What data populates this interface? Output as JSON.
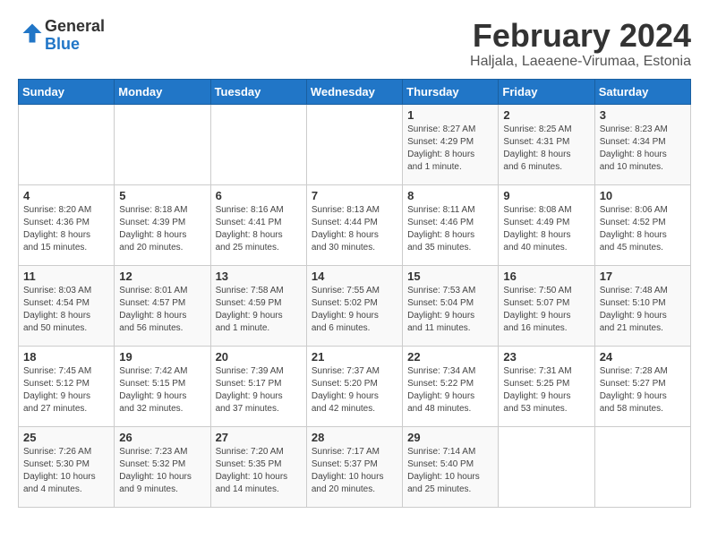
{
  "header": {
    "logo_general": "General",
    "logo_blue": "Blue",
    "title": "February 2024",
    "subtitle": "Haljala, Laeaene-Virumaa, Estonia"
  },
  "weekdays": [
    "Sunday",
    "Monday",
    "Tuesday",
    "Wednesday",
    "Thursday",
    "Friday",
    "Saturday"
  ],
  "weeks": [
    [
      {
        "day": "",
        "info": ""
      },
      {
        "day": "",
        "info": ""
      },
      {
        "day": "",
        "info": ""
      },
      {
        "day": "",
        "info": ""
      },
      {
        "day": "1",
        "info": "Sunrise: 8:27 AM\nSunset: 4:29 PM\nDaylight: 8 hours\nand 1 minute."
      },
      {
        "day": "2",
        "info": "Sunrise: 8:25 AM\nSunset: 4:31 PM\nDaylight: 8 hours\nand 6 minutes."
      },
      {
        "day": "3",
        "info": "Sunrise: 8:23 AM\nSunset: 4:34 PM\nDaylight: 8 hours\nand 10 minutes."
      }
    ],
    [
      {
        "day": "4",
        "info": "Sunrise: 8:20 AM\nSunset: 4:36 PM\nDaylight: 8 hours\nand 15 minutes."
      },
      {
        "day": "5",
        "info": "Sunrise: 8:18 AM\nSunset: 4:39 PM\nDaylight: 8 hours\nand 20 minutes."
      },
      {
        "day": "6",
        "info": "Sunrise: 8:16 AM\nSunset: 4:41 PM\nDaylight: 8 hours\nand 25 minutes."
      },
      {
        "day": "7",
        "info": "Sunrise: 8:13 AM\nSunset: 4:44 PM\nDaylight: 8 hours\nand 30 minutes."
      },
      {
        "day": "8",
        "info": "Sunrise: 8:11 AM\nSunset: 4:46 PM\nDaylight: 8 hours\nand 35 minutes."
      },
      {
        "day": "9",
        "info": "Sunrise: 8:08 AM\nSunset: 4:49 PM\nDaylight: 8 hours\nand 40 minutes."
      },
      {
        "day": "10",
        "info": "Sunrise: 8:06 AM\nSunset: 4:52 PM\nDaylight: 8 hours\nand 45 minutes."
      }
    ],
    [
      {
        "day": "11",
        "info": "Sunrise: 8:03 AM\nSunset: 4:54 PM\nDaylight: 8 hours\nand 50 minutes."
      },
      {
        "day": "12",
        "info": "Sunrise: 8:01 AM\nSunset: 4:57 PM\nDaylight: 8 hours\nand 56 minutes."
      },
      {
        "day": "13",
        "info": "Sunrise: 7:58 AM\nSunset: 4:59 PM\nDaylight: 9 hours\nand 1 minute."
      },
      {
        "day": "14",
        "info": "Sunrise: 7:55 AM\nSunset: 5:02 PM\nDaylight: 9 hours\nand 6 minutes."
      },
      {
        "day": "15",
        "info": "Sunrise: 7:53 AM\nSunset: 5:04 PM\nDaylight: 9 hours\nand 11 minutes."
      },
      {
        "day": "16",
        "info": "Sunrise: 7:50 AM\nSunset: 5:07 PM\nDaylight: 9 hours\nand 16 minutes."
      },
      {
        "day": "17",
        "info": "Sunrise: 7:48 AM\nSunset: 5:10 PM\nDaylight: 9 hours\nand 21 minutes."
      }
    ],
    [
      {
        "day": "18",
        "info": "Sunrise: 7:45 AM\nSunset: 5:12 PM\nDaylight: 9 hours\nand 27 minutes."
      },
      {
        "day": "19",
        "info": "Sunrise: 7:42 AM\nSunset: 5:15 PM\nDaylight: 9 hours\nand 32 minutes."
      },
      {
        "day": "20",
        "info": "Sunrise: 7:39 AM\nSunset: 5:17 PM\nDaylight: 9 hours\nand 37 minutes."
      },
      {
        "day": "21",
        "info": "Sunrise: 7:37 AM\nSunset: 5:20 PM\nDaylight: 9 hours\nand 42 minutes."
      },
      {
        "day": "22",
        "info": "Sunrise: 7:34 AM\nSunset: 5:22 PM\nDaylight: 9 hours\nand 48 minutes."
      },
      {
        "day": "23",
        "info": "Sunrise: 7:31 AM\nSunset: 5:25 PM\nDaylight: 9 hours\nand 53 minutes."
      },
      {
        "day": "24",
        "info": "Sunrise: 7:28 AM\nSunset: 5:27 PM\nDaylight: 9 hours\nand 58 minutes."
      }
    ],
    [
      {
        "day": "25",
        "info": "Sunrise: 7:26 AM\nSunset: 5:30 PM\nDaylight: 10 hours\nand 4 minutes."
      },
      {
        "day": "26",
        "info": "Sunrise: 7:23 AM\nSunset: 5:32 PM\nDaylight: 10 hours\nand 9 minutes."
      },
      {
        "day": "27",
        "info": "Sunrise: 7:20 AM\nSunset: 5:35 PM\nDaylight: 10 hours\nand 14 minutes."
      },
      {
        "day": "28",
        "info": "Sunrise: 7:17 AM\nSunset: 5:37 PM\nDaylight: 10 hours\nand 20 minutes."
      },
      {
        "day": "29",
        "info": "Sunrise: 7:14 AM\nSunset: 5:40 PM\nDaylight: 10 hours\nand 25 minutes."
      },
      {
        "day": "",
        "info": ""
      },
      {
        "day": "",
        "info": ""
      }
    ]
  ]
}
